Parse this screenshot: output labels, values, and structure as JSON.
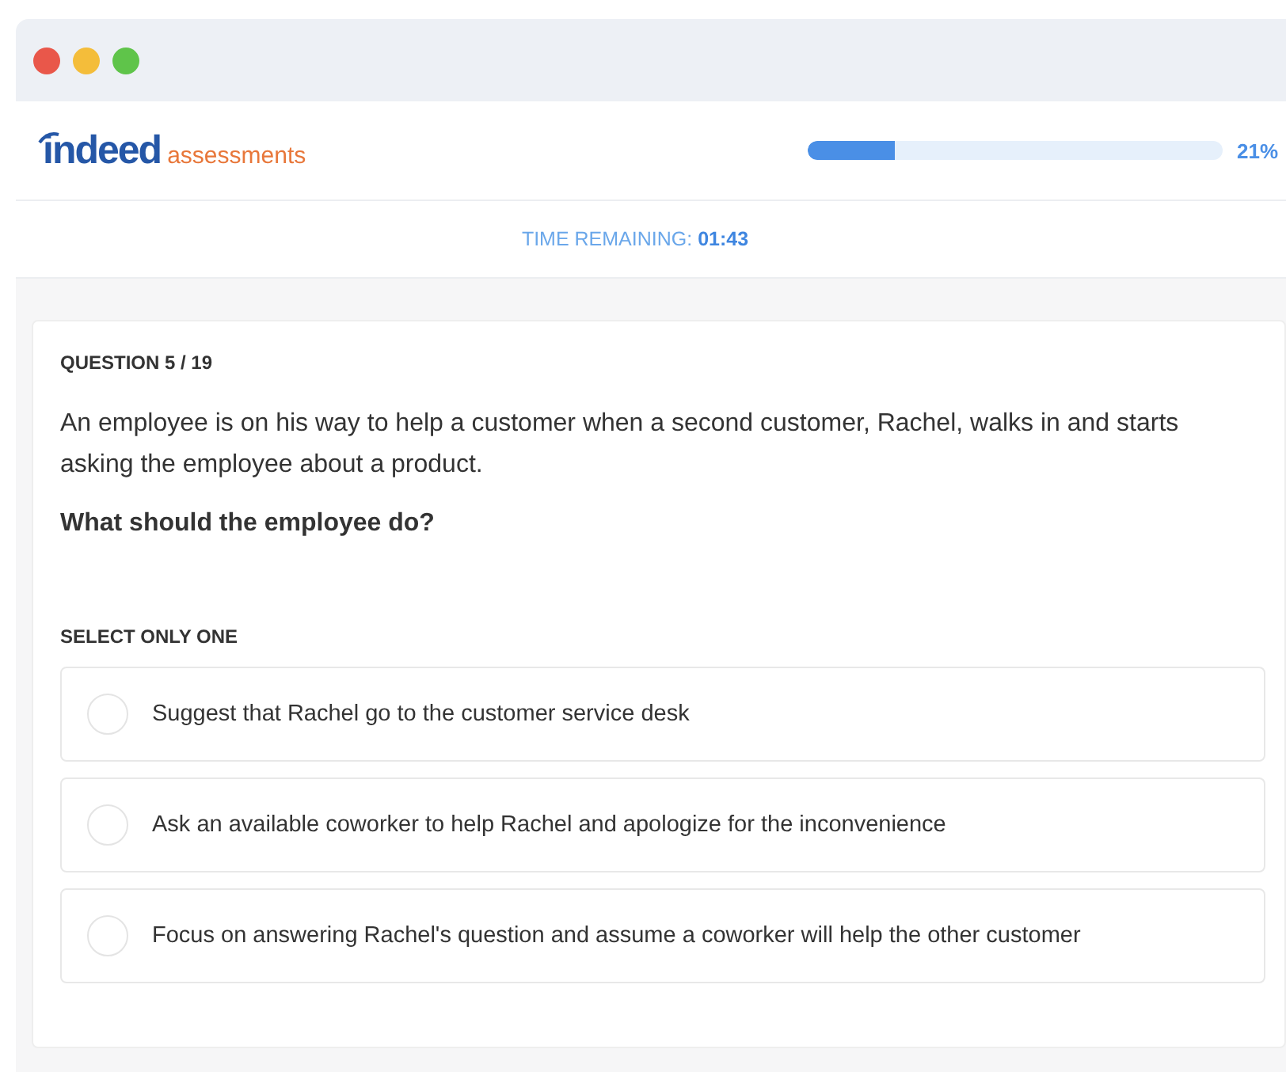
{
  "window": {
    "controls": [
      {
        "color": "#e9574a"
      },
      {
        "color": "#f4bd3a"
      },
      {
        "color": "#5fc44a"
      }
    ]
  },
  "header": {
    "logo": {
      "word": "indeed",
      "suffix": "assessments"
    },
    "progress": {
      "level": 0.21,
      "reading": "21%"
    }
  },
  "timer": {
    "label": "TIME REMAINING:",
    "value": "01:43"
  },
  "question": {
    "counter": "QUESTION 5 / 19",
    "text": "An employee is on his way to help a customer when a second customer, Rachel, walks in and starts asking the employee about a product.",
    "prompt": "What should the employee do?",
    "instruction": "SELECT ONLY ONE",
    "options": [
      {
        "label": "Suggest that Rachel go to the customer service desk",
        "selected": false
      },
      {
        "label": "Ask an available coworker to help Rachel and apologize for the inconvenience",
        "selected": false
      },
      {
        "label": "Focus on answering Rachel's question and assume a coworker will help the other customer",
        "selected": false
      }
    ]
  }
}
